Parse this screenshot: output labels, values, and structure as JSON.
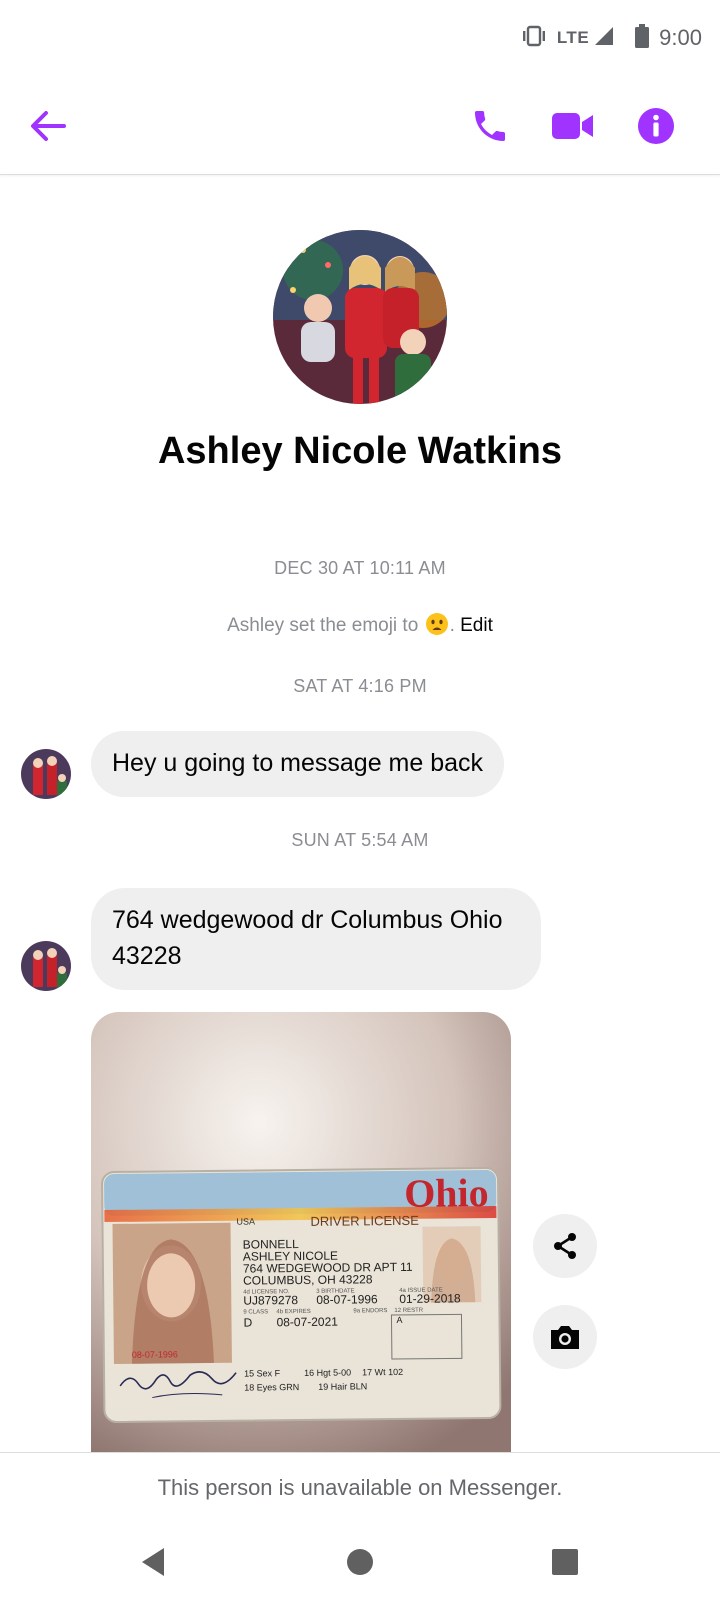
{
  "status_bar": {
    "network": "LTE",
    "time": "9:00"
  },
  "header": {
    "back_icon": "arrow-left-icon",
    "call_icon": "phone-icon",
    "video_icon": "video-camera-icon",
    "info_icon": "info-icon",
    "accent_color": "#a033ff"
  },
  "profile": {
    "name": "Ashley Nicole Watkins"
  },
  "conversation": {
    "timestamp_1": "DEC 30 AT 10:11 AM",
    "system_message": {
      "prefix": "Ashley set the emoji to",
      "emoji": "worried-face-emoji",
      "suffix": ".",
      "action": "Edit"
    },
    "timestamp_2": "SAT AT 4:16 PM",
    "message_1": "Hey u going to message me back",
    "timestamp_3": "SUN AT 5:54 AM",
    "message_2_line1": "764 wedgewood dr Columbus Ohio",
    "message_2_line2": "43228",
    "photo": {
      "state": "Ohio",
      "title": "DRIVER LICENSE",
      "country": "USA",
      "last_name": "BONNELL",
      "first_name": "ASHLEY NICOLE",
      "address_line1": "764 WEDGEWOOD DR APT 11",
      "address_line2": "COLUMBUS, OH 43228",
      "license_label": "4d LICENSE NO.",
      "license_no": "UJ879278",
      "birthdate_label": "3 BIRTHDATE",
      "birthdate": "08-07-1996",
      "issue_label": "4a ISSUE DATE",
      "issue_date": "01-29-2018",
      "class_label": "9 CLASS",
      "expires_label": "4b EXPIRES",
      "endors_label": "9a ENDORS",
      "restr_label": "12 RESTR",
      "class": "D",
      "expires": "08-07-2021",
      "restr": "A",
      "dob_stamp": "08-07-1996",
      "sex": "15 Sex F",
      "height": "16 Hgt 5-00",
      "weight": "17 Wt 102",
      "eyes": "18 Eyes GRN",
      "hair": "19 Hair BLN"
    },
    "share_icon": "share-icon",
    "camera_icon": "camera-icon"
  },
  "footer": {
    "unavailable_text": "This person is unavailable on Messenger."
  },
  "nav": {
    "back": "nav-back-icon",
    "home": "nav-home-icon",
    "recents": "nav-recents-icon"
  }
}
